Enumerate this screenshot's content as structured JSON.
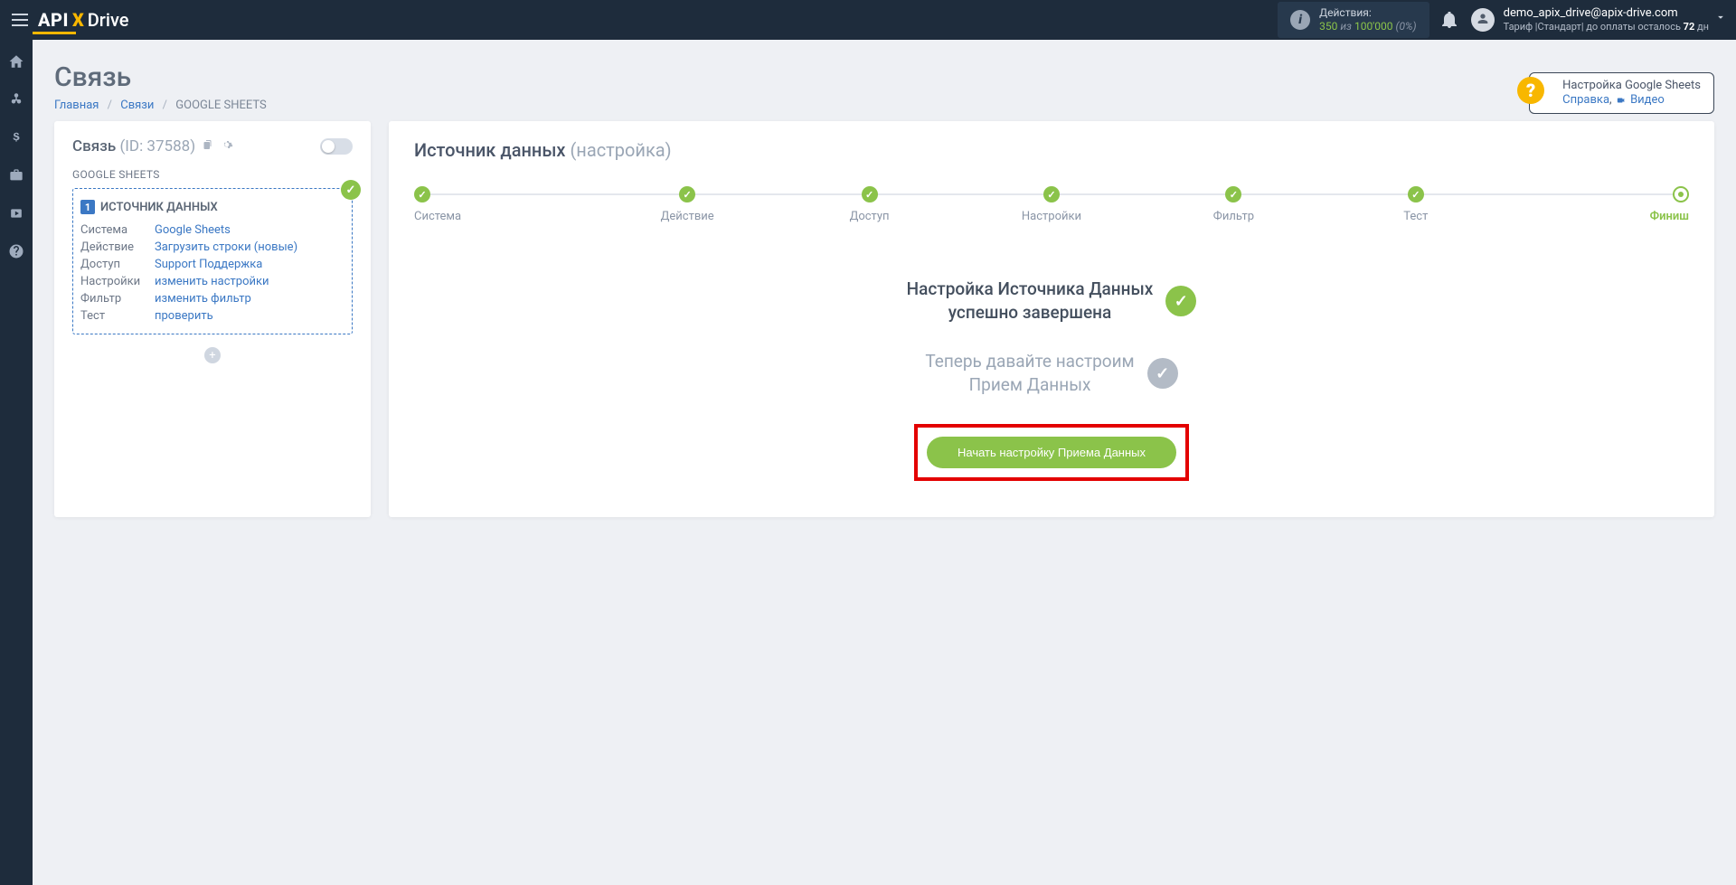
{
  "brand": {
    "part1": "API",
    "part2": "X",
    "part3": "Drive"
  },
  "topnav": {
    "actions": {
      "label": "Действия:",
      "used": "350",
      "of_word": "из",
      "limit": "100'000",
      "pct": "(0%)"
    },
    "user": {
      "email": "demo_apix_drive@apix-drive.com",
      "plan_prefix": "Тариф ",
      "plan_name": "|Стандарт|",
      "plan_suffix": " до оплаты осталось ",
      "days": "72",
      "days_unit": " дн"
    }
  },
  "page": {
    "title": "Связь",
    "help": {
      "line1": "Настройка Google Sheets",
      "link_help": "Справка",
      "link_video": "Видео"
    }
  },
  "breadcrumb": {
    "home": "Главная",
    "conns": "Связи",
    "current": "GOOGLE SHEETS"
  },
  "left": {
    "title_main": "Связь",
    "title_id_prefix": "(ID: ",
    "title_id": "37588",
    "title_id_suffix": ")",
    "subtitle": "GOOGLE SHEETS",
    "box_idx": "1",
    "box_head": "ИСТОЧНИК ДАННЫХ",
    "rows": [
      {
        "k": "Система",
        "v": "Google Sheets"
      },
      {
        "k": "Действие",
        "v": "Загрузить строки (новые)"
      },
      {
        "k": "Доступ",
        "v": "Support Поддержка"
      },
      {
        "k": "Настройки",
        "v": "изменить настройки"
      },
      {
        "k": "Фильтр",
        "v": "изменить фильтр"
      },
      {
        "k": "Тест",
        "v": "проверить"
      }
    ]
  },
  "right": {
    "title_main": "Источник данных",
    "title_soft": "(настройка)",
    "steps": [
      "Система",
      "Действие",
      "Доступ",
      "Настройки",
      "Фильтр",
      "Тест",
      "Финиш"
    ],
    "msg_done_1": "Настройка Источника Данных",
    "msg_done_2": "успешно завершена",
    "msg_next_1": "Теперь давайте настроим",
    "msg_next_2": "Прием Данных",
    "cta": "Начать настройку Приема Данных"
  }
}
